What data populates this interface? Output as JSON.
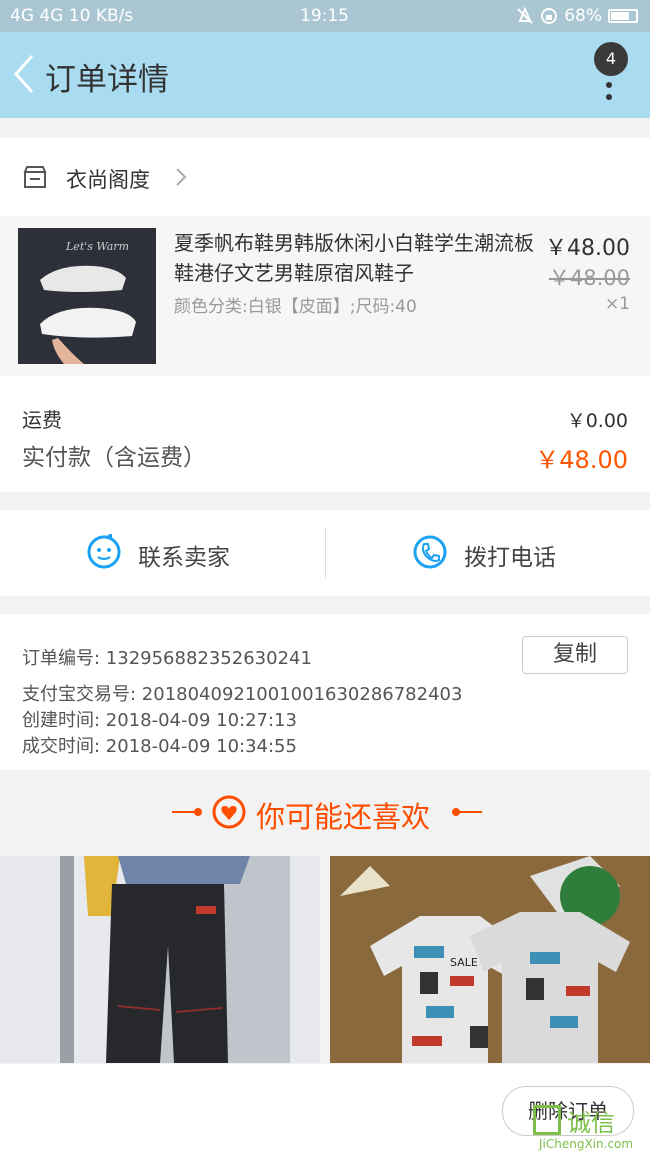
{
  "status": {
    "network": "4G 4G",
    "speed": "10 KB/s",
    "time": "19:15",
    "battery": "68%",
    "battery_level": 0.68
  },
  "header": {
    "title": "订单详情",
    "badge": "4"
  },
  "store": {
    "name": "衣尚阁度"
  },
  "item": {
    "title": "夏季帆布鞋男韩版休闲小白鞋学生潮流板鞋港仔文艺男鞋原宿风鞋子",
    "sku": "颜色分类:白银【皮面】;尺码:40",
    "price": "￥48.00",
    "original_price": "￥48.00",
    "quantity": "×1",
    "thumb_caption": "Let's Warm"
  },
  "fees": {
    "shipping_label": "运费",
    "shipping_value": "￥0.00",
    "paid_label": "实付款（含运费）",
    "paid_value": "￥48.00"
  },
  "contact": {
    "seller": "联系卖家",
    "call": "拨打电话"
  },
  "info": {
    "order_no": "订单编号:   132956882352630241",
    "alipay_no": "支付宝交易号:   2018040921001001630286782403",
    "created": "创建时间:   2018-04-09  10:27:13",
    "closed": "成交时间:   2018-04-09  10:34:55",
    "copy": "复制"
  },
  "recommend": {
    "title": "你可能还喜欢"
  },
  "products": [
    {
      "name": "product-jeans"
    },
    {
      "name": "product-tshirts",
      "print": "SALE"
    }
  ],
  "actions": {
    "delete": "删除订单"
  },
  "watermark": {
    "title": "诚信",
    "site": "JiChengXin.com"
  },
  "colors": {
    "header": "#a9dcf1",
    "status_bar": "#a9c6d2",
    "accent": "#ff5500",
    "icon_blue": "#1da1f2"
  }
}
